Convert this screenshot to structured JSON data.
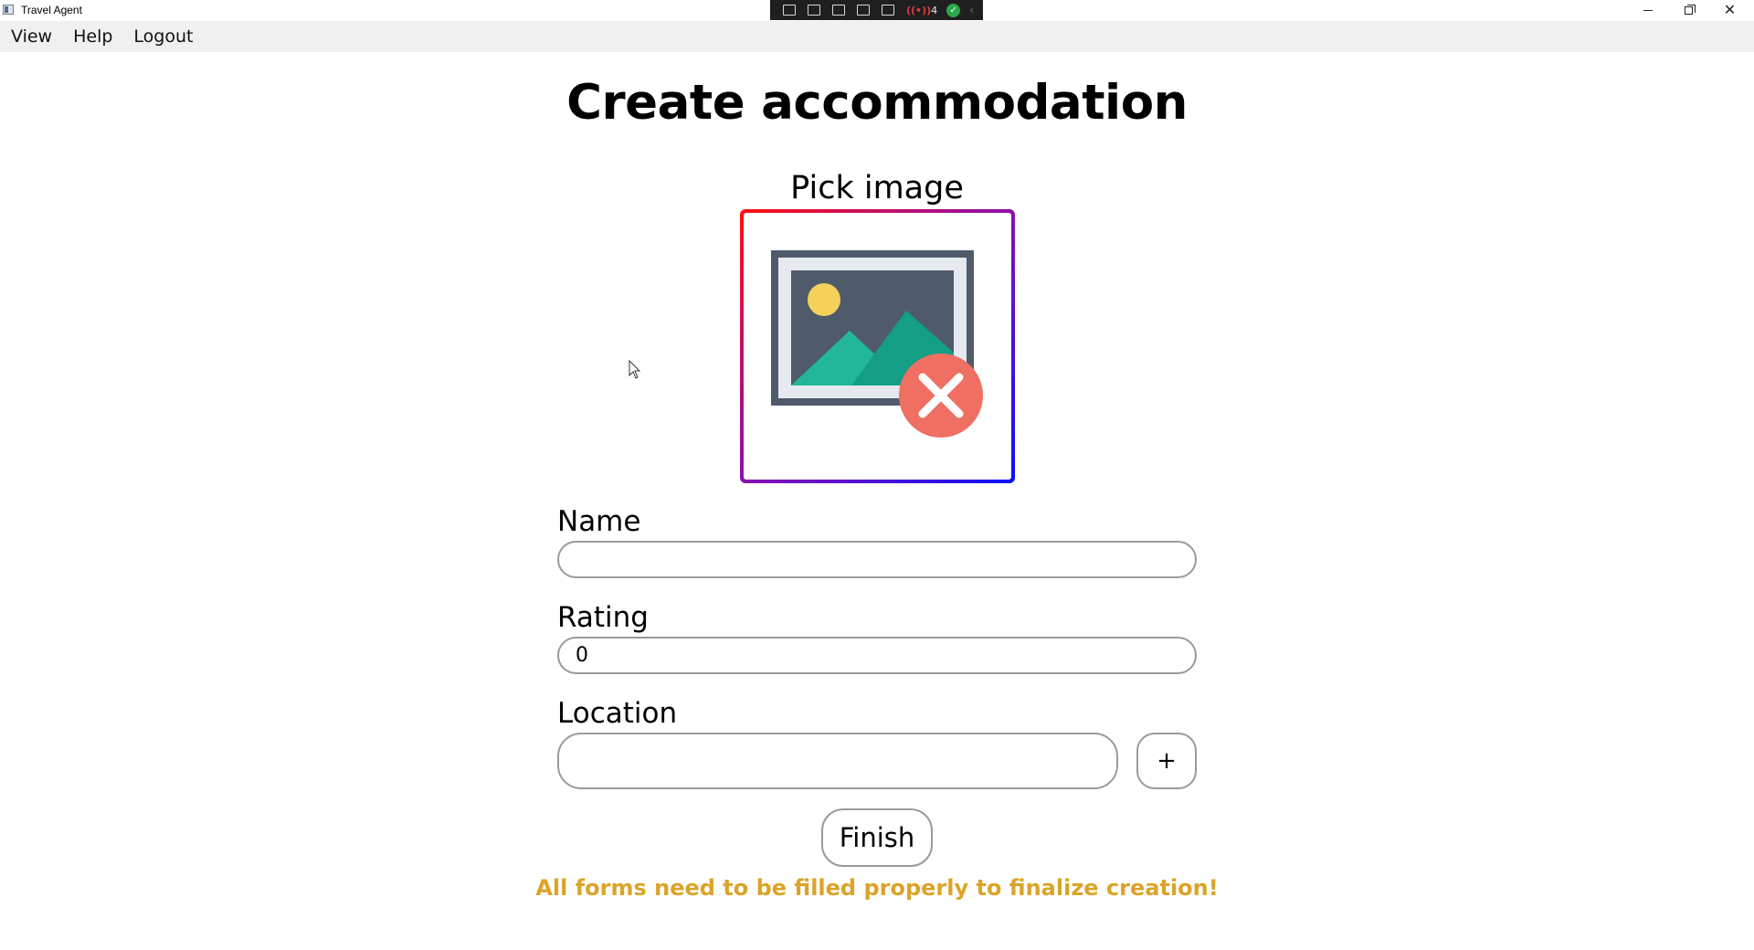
{
  "window": {
    "title": "Travel Agent",
    "recording_indicator": "4"
  },
  "menu": {
    "items": [
      "View",
      "Help",
      "Logout"
    ]
  },
  "page": {
    "title": "Create accommodation",
    "pick_image_label": "Pick image",
    "image_state": "image-missing-icon"
  },
  "form": {
    "name": {
      "label": "Name",
      "value": ""
    },
    "rating": {
      "label": "Rating",
      "value": "0"
    },
    "location": {
      "label": "Location",
      "value": "",
      "add_button": "+"
    },
    "finish_label": "Finish",
    "warning": "All forms need to be filled properly to finalize creation!"
  },
  "colors": {
    "warning": "#dba428",
    "frame_gradient_start": "#ff1010",
    "frame_gradient_end": "#0a10ff",
    "input_border": "#9a9a9a",
    "menubar_bg": "#f0f0f0"
  }
}
